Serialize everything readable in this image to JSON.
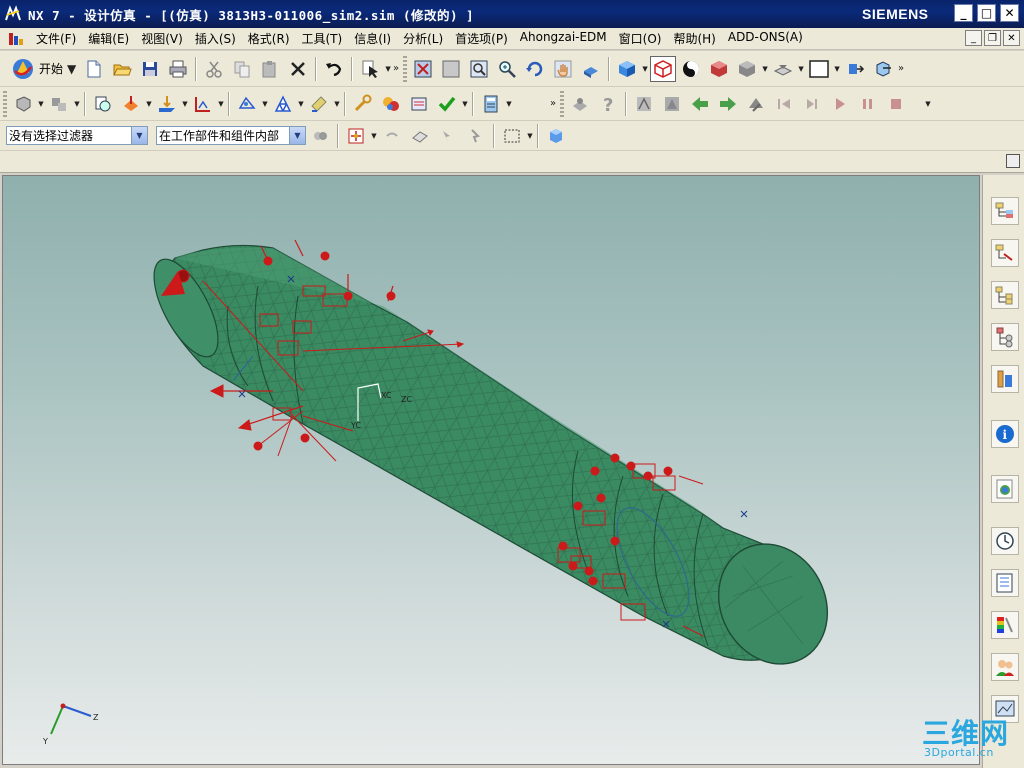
{
  "window": {
    "title": "NX 7 - 设计仿真 - [(仿真) 3813H3-011006_sim2.sim  (修改的) ]",
    "brand": "SIEMENS",
    "buttons": {
      "minimize": "_",
      "maximize": "□",
      "close": "✕"
    }
  },
  "menu": {
    "items": [
      "文件(F)",
      "编辑(E)",
      "视图(V)",
      "插入(S)",
      "格式(R)",
      "工具(T)",
      "信息(I)",
      "分析(L)",
      "首选项(P)",
      "Ahongzai-EDM",
      "窗口(O)",
      "帮助(H)",
      "ADD-ONS(A)"
    ]
  },
  "toolbar": {
    "start_label": "开始",
    "filter_value": "没有选择过滤器",
    "scope_value": "在工作部件和组件内部"
  },
  "viewport": {
    "wcs_labels": {
      "xc": "XC",
      "yc": "YC",
      "zc": "ZC"
    },
    "triad_labels": {
      "y": "Y",
      "z": "Z"
    }
  },
  "watermark": {
    "big": "三维网",
    "small": "3Dportal.cn"
  },
  "colors": {
    "title_bar": "#0a246a",
    "model_green": "#3a8a62",
    "load_red": "#cc1a1a",
    "viewport_top": "#8fb0ad"
  },
  "icons": {
    "resource_bar": [
      "assembly-navigator-icon",
      "constraint-navigator-icon",
      "part-navigator-icon",
      "simulation-navigator-icon",
      "reuse-library-icon",
      "info-icon",
      "web-browser-icon",
      "history-icon",
      "system-materials-icon",
      "palette-icon",
      "roles-icon",
      "3d-browser-icon"
    ]
  }
}
